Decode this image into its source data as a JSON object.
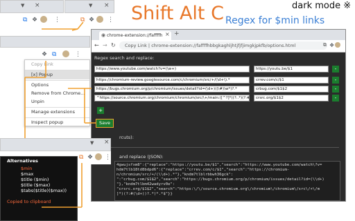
{
  "title": "Shift Alt C",
  "subtitle": "Regex for $min links",
  "dark_mode_label": "dark mode ※",
  "colors": {
    "accent_orange": "#f0a030",
    "title_orange": "#e8782a",
    "subtitle_blue": "#3a7fd5",
    "green": "#1b7d2e",
    "dark_bg": "#2b2b2b",
    "alt_highlight": "#ff6b3d"
  },
  "top_toolbar": {
    "tab_close": "×"
  },
  "popup_toolbar": {
    "tab_close": "×"
  },
  "context_menu": {
    "items": [
      {
        "label": "Copy Link",
        "disabled": true
      },
      {
        "label": "[x] Popup",
        "highlighted": true
      },
      {
        "label": "Options"
      },
      {
        "label": "Remove from Chrome..."
      },
      {
        "label": "Unpin"
      },
      {
        "label": "Manage extensions"
      },
      {
        "label": "Inspect popup"
      }
    ]
  },
  "options_window": {
    "tab_title": "chrome-extension://faffffhbbgkaghljhtjfjfjimgkjpkfb/options.html",
    "tab_close": "×",
    "new_tab": "+",
    "address": "Copy Link  |  chrome-extension://faffffhbbgkaghljhtjfjfjimgkjpkfb/options.html",
    "heading": "Regex search and replace:",
    "rows": [
      {
        "search": "https://www.youtube.com/watch?v=(\\w+)",
        "replace": "https://youtu.be/$1"
      },
      {
        "search": "https://chromium-review.googlesource.com/c/chromium/src/+/(\\d+\\).*",
        "replace": "crrev.com/c/$1"
      },
      {
        "search": "https://bugs.chromium.org/p/chromium/issues/detail?id=(\\d+)((\\#)\\w*)?.*",
        "replace": "crbug.com/$1$2"
      },
      {
        "search": "^https://source.chromium.org/chromium/chromium/src/\\+/main:([^?]*)(?:.*)(?:#(\\d+))?.*$",
        "replace": "crsrc.org/$1$2"
      }
    ],
    "remove_label": "-",
    "add_label": "+",
    "save_label": "Save",
    "shortcuts_label": "rcuts):",
    "json_heading": "and replace (JSON):",
    "json_lines": [
      "4gwujsfxm8\":{\"replace\":\"https://youtu.be/$1\",\"search\":\"https://www.youtube.com/watch\\?v=",
      "hdm7tlb18td8bdpd6\":{\"replace\":\"crrev.com/c/$1\",\"search\":\"https://chromium-",
      "n/chromium/src/+/(\\\\d+).*\"},\"kndm7tlblrbbwh36gck\":",
      "\":\"crbug.com/$1$2\",\"search\":\"https://bugs.chromium.org/p/chromium/issues/detail?id=(\\\\d+)",
      "\"},\"kndm7tlbm42wadyrv0e\":",
      "\"crsrc.org/$1$2\",\"search\":\"https:\\/\\/source.chromium.org\\/chromium\\/chromium\\/src\\/+\\/m",
      "]*)(?:#(\\d+))?.*)*.*$\"}}"
    ]
  },
  "popup": {
    "heading": "Alternatives",
    "items": [
      "$min",
      "$max",
      "$title ($min)",
      "$title ($max)",
      "$tabs($title)($max))"
    ],
    "status": "Copied to clipboard"
  }
}
